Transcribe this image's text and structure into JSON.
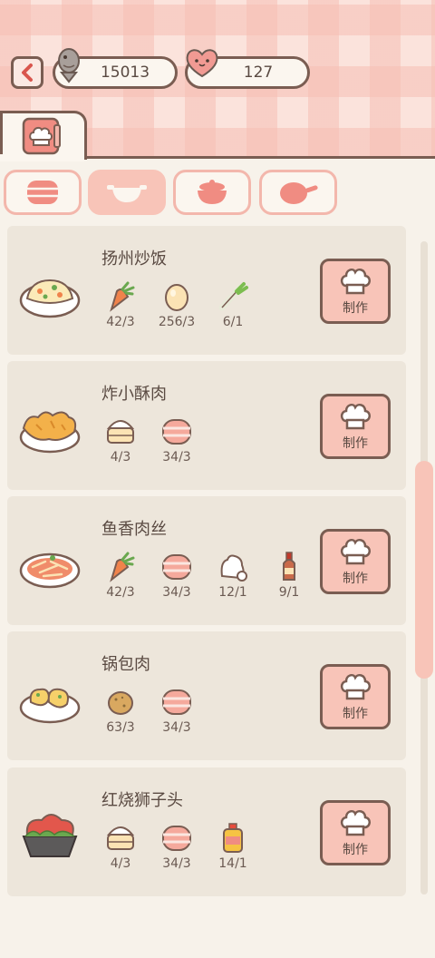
{
  "header": {
    "back_icon": "chevron-left-icon",
    "coins": "15013",
    "hearts": "127"
  },
  "tabs": {
    "main_tab_icon": "recipe-book-icon",
    "categories": [
      {
        "icon": "steamer-icon",
        "active": false
      },
      {
        "icon": "wok-icon",
        "active": true
      },
      {
        "icon": "pot-icon",
        "active": false
      },
      {
        "icon": "pan-icon",
        "active": false
      }
    ]
  },
  "recipes": [
    {
      "name": "扬州炒饭",
      "dish_icon": "fried-rice-icon",
      "ingredients": [
        {
          "icon": "carrot-icon",
          "count": "42/3"
        },
        {
          "icon": "egg-icon",
          "count": "256/3"
        },
        {
          "icon": "scallion-icon",
          "count": "6/1"
        }
      ],
      "button": "制作"
    },
    {
      "name": "炸小酥肉",
      "dish_icon": "fried-pork-icon",
      "ingredients": [
        {
          "icon": "flour-icon",
          "count": "4/3"
        },
        {
          "icon": "pork-icon",
          "count": "34/3"
        }
      ],
      "button": "制作"
    },
    {
      "name": "鱼香肉丝",
      "dish_icon": "shredded-pork-icon",
      "ingredients": [
        {
          "icon": "carrot-icon",
          "count": "42/3"
        },
        {
          "icon": "pork-icon",
          "count": "34/3"
        },
        {
          "icon": "sugar-icon",
          "count": "12/1"
        },
        {
          "icon": "sauce-bottle-icon",
          "count": "9/1"
        }
      ],
      "button": "制作"
    },
    {
      "name": "锅包肉",
      "dish_icon": "sweet-sour-pork-icon",
      "ingredients": [
        {
          "icon": "potato-icon",
          "count": "63/3"
        },
        {
          "icon": "pork-icon",
          "count": "34/3"
        }
      ],
      "button": "制作"
    },
    {
      "name": "红烧狮子头",
      "dish_icon": "meatball-icon",
      "ingredients": [
        {
          "icon": "flour-icon",
          "count": "4/3"
        },
        {
          "icon": "pork-icon",
          "count": "34/3"
        },
        {
          "icon": "oil-bottle-icon",
          "count": "14/1"
        }
      ],
      "button": "制作"
    }
  ],
  "colors": {
    "accent": "#f8c4b8",
    "outline": "#7a5d52",
    "card": "#ede6db",
    "panel": "#f7f2ea"
  }
}
